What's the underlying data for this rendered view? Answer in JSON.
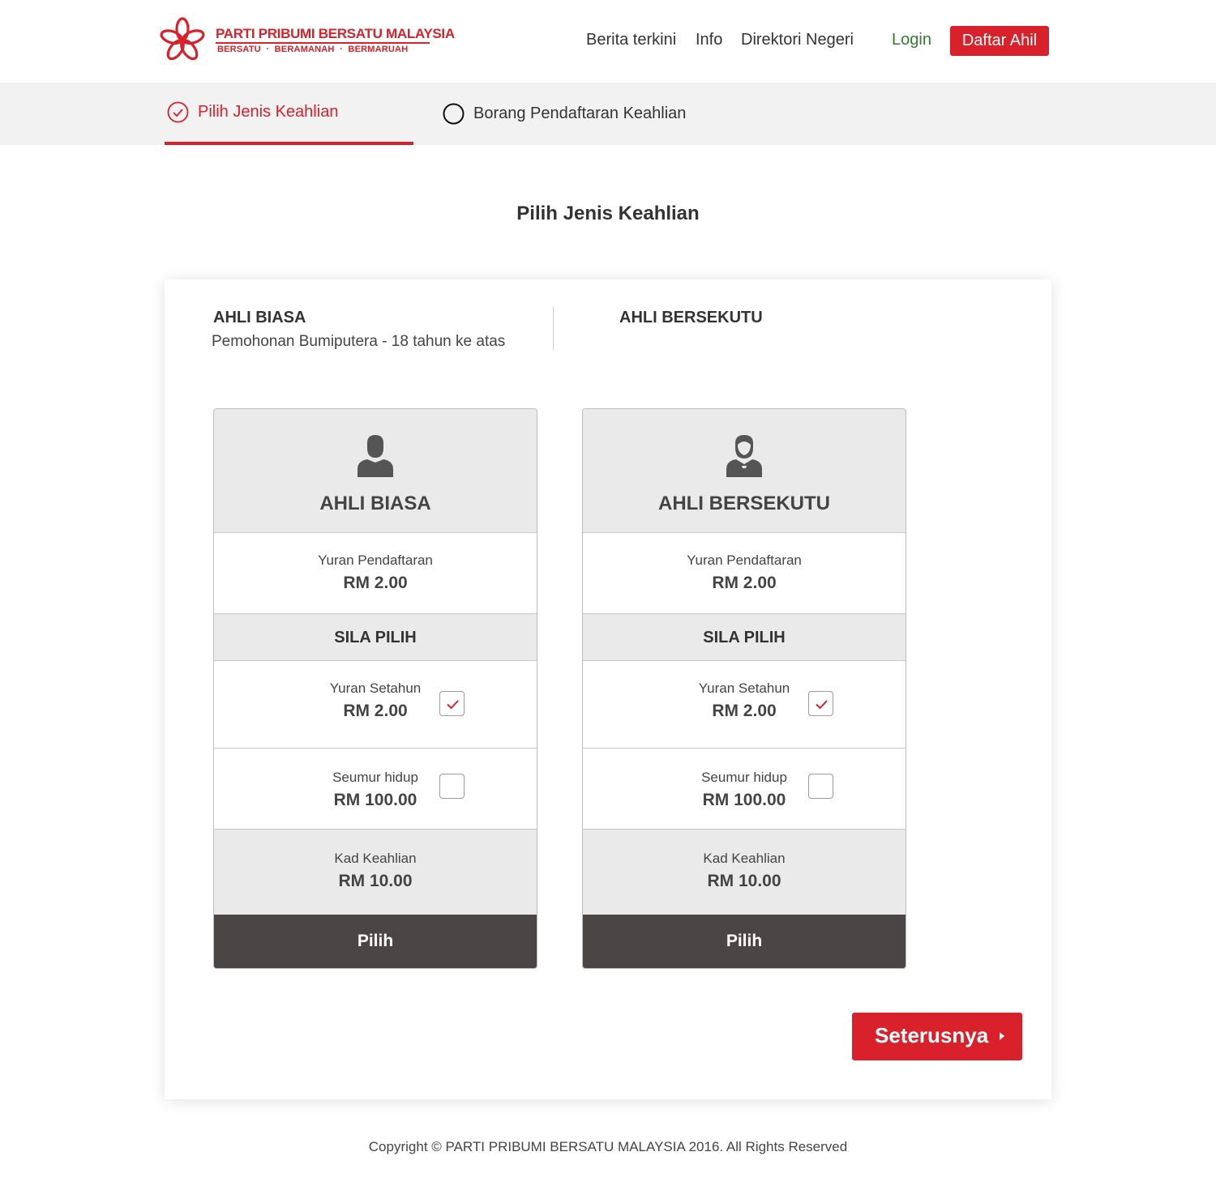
{
  "brand": {
    "title": "PARTI PRIBUMI BERSATU MALAYSIA",
    "tagline": "BERSATU  ·  BERAMANAH  ·  BERMARUAH",
    "color": "#d8212a"
  },
  "nav": {
    "items": [
      "Berita terkini",
      "Info",
      "Direktori Negeri"
    ],
    "login": "Login",
    "register": "Daftar Ahil"
  },
  "steps": [
    {
      "label": "Pilih Jenis Keahlian",
      "state": "active",
      "icon": "check-circle-icon"
    },
    {
      "label": "Borang Pendaftaran Keahlian",
      "state": "pending",
      "icon": "circle-icon"
    }
  ],
  "page_title": "Pilih Jenis Keahlian",
  "tabs": {
    "left_title": "AHLI BIASA",
    "left_subtitle": "Pemohonan Bumiputera - 18 tahun ke atas",
    "right_title": "AHLI BERSEKUTU"
  },
  "plans": [
    {
      "name": "AHLI BIASA",
      "icon": "user-icon",
      "fee_label": "Yuran Pendaftaran",
      "fee_value": "RM 2.00",
      "choose_label": "SILA PILIH",
      "options": [
        {
          "label": "Yuran Setahun",
          "value": "RM 2.00",
          "checked": true
        },
        {
          "label": "Seumur hidup",
          "value": "RM 100.00",
          "checked": false
        }
      ],
      "card_label": "Kad Keahlian",
      "card_value": "RM 10.00",
      "button": "Pilih"
    },
    {
      "name": "AHLI BERSEKUTU",
      "icon": "user-tie-icon",
      "fee_label": "Yuran Pendaftaran",
      "fee_value": "RM 2.00",
      "choose_label": "SILA PILIH",
      "options": [
        {
          "label": "Yuran Setahun",
          "value": "RM 2.00",
          "checked": true
        },
        {
          "label": "Seumur hidup",
          "value": "RM 100.00",
          "checked": false
        }
      ],
      "card_label": "Kad Keahlian",
      "card_value": "RM 10.00",
      "button": "Pilih"
    }
  ],
  "next_button": "Seterusnya",
  "footer": "Copyright © PARTI PRIBUMI BERSATU MALAYSIA 2016. All Rights Reserved"
}
